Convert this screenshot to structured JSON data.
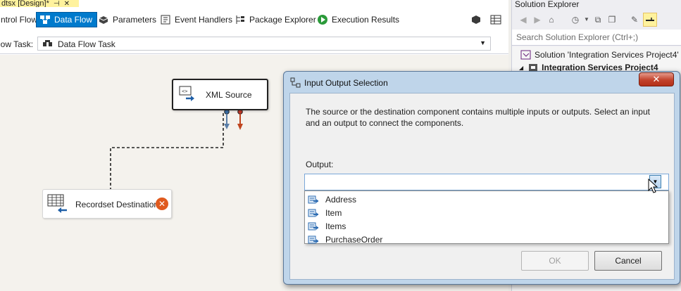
{
  "document_tab": {
    "title": "dtsx [Design]*"
  },
  "designer_tabs": [
    {
      "label": "ntrol Flow",
      "icon": "control-flow-icon"
    },
    {
      "label": "Data Flow",
      "icon": "data-flow-icon",
      "active": true
    },
    {
      "label": "Parameters",
      "icon": "parameters-icon"
    },
    {
      "label": "Event Handlers",
      "icon": "event-handlers-icon"
    },
    {
      "label": "Package Explorer",
      "icon": "package-explorer-icon"
    },
    {
      "label": "Execution Results",
      "icon": "execution-results-icon"
    }
  ],
  "task_row": {
    "label": "low Task:",
    "value": "Data Flow Task"
  },
  "components": {
    "xml_source": "XML Source",
    "recordset_destination": "Recordset Destination"
  },
  "solution_explorer": {
    "title": "Solution Explorer",
    "search_placeholder": "Search Solution Explorer (Ctrl+;)",
    "solution": "Solution 'Integration Services Project4' (",
    "project": "Integration Services Project4"
  },
  "dialog": {
    "title": "Input Output Selection",
    "message": "The source or the destination component contains multiple inputs or outputs. Select an input and an output to connect the components.",
    "output_label": "Output:",
    "output_value": "",
    "options": [
      "Address",
      "Item",
      "Items",
      "PurchaseOrder"
    ],
    "ok": "OK",
    "cancel": "Cancel",
    "close": "✕"
  },
  "colors": {
    "accent": "#007acc",
    "tab_highlight": "#fff29d",
    "dialog_frame": "#bfd5ea",
    "close_button": "#c2422b",
    "error": "#e05a1e"
  }
}
